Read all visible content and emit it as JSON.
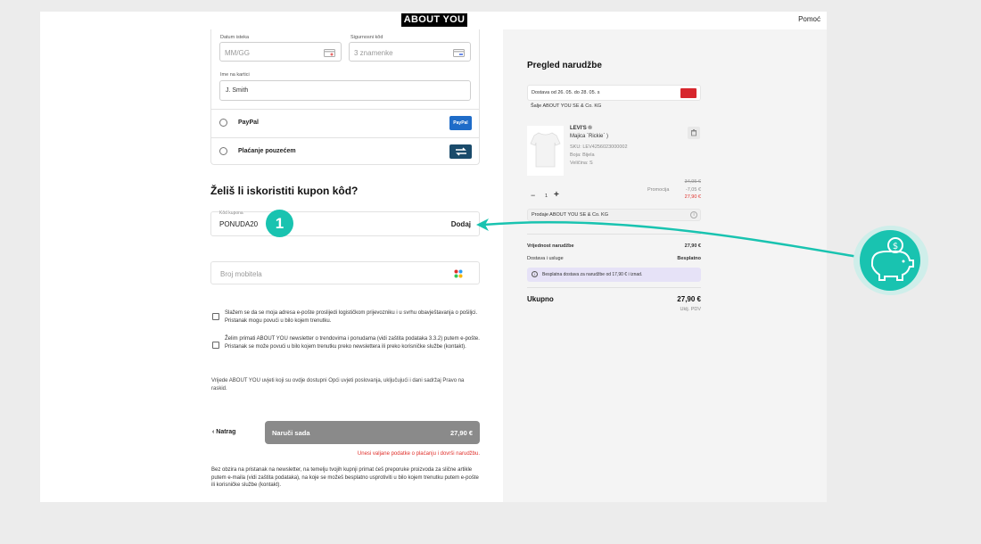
{
  "header": {
    "logo": "ABOUT YOU",
    "help": "Pomoć"
  },
  "card": {
    "expiry_label": "Datum isteka",
    "expiry_placeholder": "MM/GG",
    "cvv_label": "Sigurnosni kôd",
    "cvv_placeholder": "3 znamenke",
    "name_label": "Ime na kartici",
    "name_value": "J. Smith"
  },
  "payment_options": [
    {
      "label": "PayPal",
      "logo": "PayPal",
      "color": "#1f6cc8"
    },
    {
      "label": "Plaćanje pouzećem",
      "logo": "cash-icon",
      "color": "#1a4b6b"
    }
  ],
  "coupon": {
    "heading": "Želiš li iskoristiti kupon kôd?",
    "field_label": "Kôd kupona",
    "value": "PONUDA20",
    "apply": "Dodaj",
    "step_number": "1"
  },
  "phone": {
    "placeholder": "Broj mobitela"
  },
  "consents": [
    "Slažem se da se moja adresa e-pošte proslijedi logističkom prijevozniku i u svrhu obavještavanja o pošiljci. Pristanak mogu povući u bilo kojem trenutku.",
    "Želim primati ABOUT YOU newsletter o trendovima i ponudama (vidi zaštita podataka 3.3.2) putem e-pošte. Pristanak se može povući u bilo kojem trenutku preko newslettera ili preko korisničke službe (kontakt)."
  ],
  "terms": "Vrijede ABOUT YOU uvjeti koji su ovdje dostupni Opći uvjeti poslovanja, uključujući i dani sadržaj Pravo na raskid.",
  "footer": {
    "back": "Natrag",
    "order_label": "Naruči sada",
    "order_total": "27,90 €",
    "error": "Unesi valjane podatke o plaćanju i dovrši narudžbu.",
    "disclaimer": "Bez obzira na pristanak na newsletter, na temelju tvojih kupnji primat ćeš preporuke proizvoda za slične artikle putem e-maila (vidi zaštita podataka), na koje se možeš besplatno usprotiviti u bilo kojem trenutku putem e-pošte ili korisničke službe (kontakt)."
  },
  "summary": {
    "title": "Pregled narudžbe",
    "delivery": "Dostava od 26. 05. do 28. 05. s",
    "ships_from": "Šalje ABOUT YOU SE & Co. KG",
    "product": {
      "brand": "LEVI'S ®",
      "name": "Majica `Rickie` )",
      "sku": "SKU: LEV4256023000002",
      "color": "Boja: Bijela",
      "size": "Veličina: S",
      "price_old": "34,95 €",
      "promo_label": "Promocija",
      "promo_value": "-7,05 €",
      "price_new": "27,90 €",
      "qty": "1"
    },
    "seller": "Prodaje ABOUT YOU SE & Co. KG",
    "order_value_label": "Vrijednost narudžbe",
    "order_value": "27,90 €",
    "shipping_label": "Dostava i usluge",
    "shipping_value": "Besplatno",
    "free_shipping_note": "Besplatna dostava za narudžbe od 17,90 € i iznad.",
    "total_label": "Ukupno",
    "total_value": "27,90 €",
    "vat_note": "Uklj. PDV"
  },
  "colors": {
    "accent": "#19c3b0",
    "error": "#e0302b",
    "button": "#8a8a8a"
  }
}
